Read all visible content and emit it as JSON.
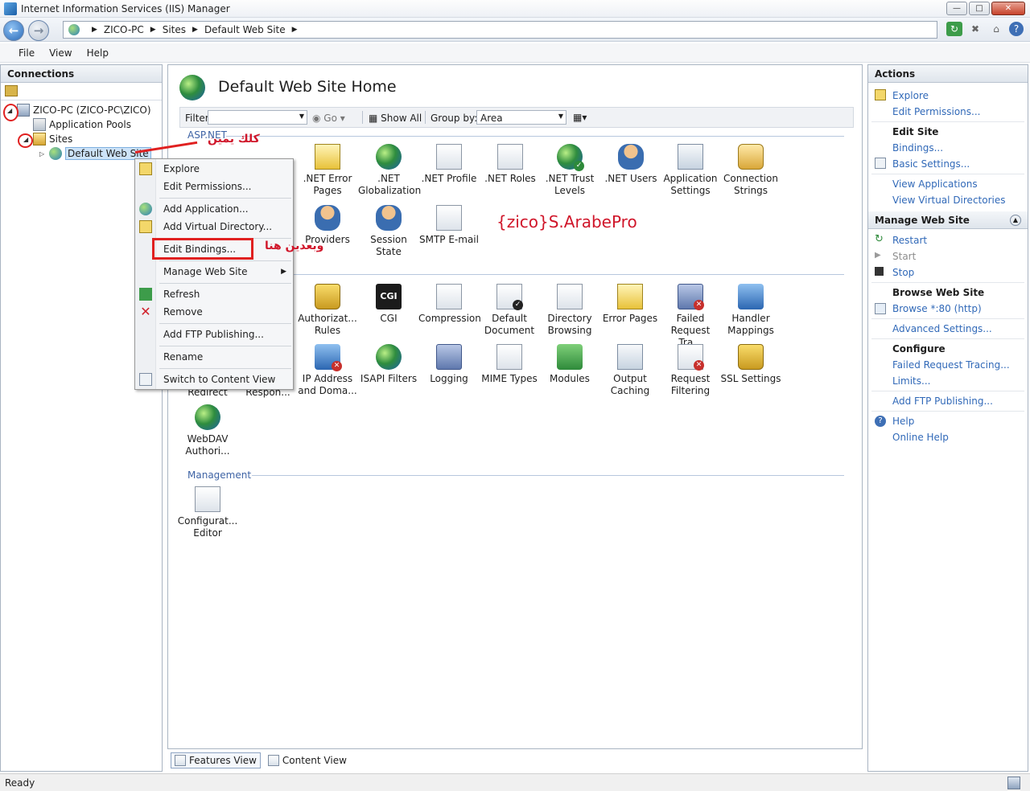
{
  "window": {
    "title": "Internet Information Services (IIS) Manager"
  },
  "address": {
    "crumbs": [
      "ZICO-PC",
      "Sites",
      "Default Web Site"
    ]
  },
  "menu": [
    "File",
    "View",
    "Help"
  ],
  "connections": {
    "header": "Connections",
    "tree": {
      "server": "ZICO-PC (ZICO-PC\\ZICO)",
      "pools": "Application Pools",
      "sites": "Sites",
      "site": "Default Web Site"
    }
  },
  "content": {
    "title": "Default Web Site Home",
    "filter": {
      "label": "Filter:",
      "go": "Go",
      "show_all": "Show All",
      "group_by": "Group by:",
      "group_value": "Area"
    },
    "sections": {
      "aspnet": "ASP.NET",
      "management": "Management"
    },
    "aspnet_items": [
      {
        "l1": ".NET Error",
        "l2": "Pages",
        "icon": "error-pages-icon"
      },
      {
        "l1": ".NET",
        "l2": "Globalization",
        "icon": "globalization-icon"
      },
      {
        "l1": ".NET Profile",
        "l2": "",
        "icon": "profile-icon"
      },
      {
        "l1": ".NET Roles",
        "l2": "",
        "icon": "roles-icon"
      },
      {
        "l1": ".NET Trust",
        "l2": "Levels",
        "icon": "trust-levels-icon"
      },
      {
        "l1": ".NET Users",
        "l2": "",
        "icon": "users-icon"
      },
      {
        "l1": "Application",
        "l2": "Settings",
        "icon": "application-settings-icon"
      },
      {
        "l1": "Connection",
        "l2": "Strings",
        "icon": "connection-strings-icon"
      }
    ],
    "aspnet_row2": [
      {
        "l1": "Providers",
        "icon": "providers-icon"
      },
      {
        "l1": "Session State",
        "icon": "session-state-icon"
      },
      {
        "l1": "SMTP E-mail",
        "icon": "smtp-email-icon"
      }
    ],
    "iis_row1": [
      {
        "l1": "Authorizat...",
        "l2": "Rules",
        "icon": "authorization-rules-icon"
      },
      {
        "l1": "CGI",
        "l2": "",
        "icon": "cgi-icon"
      },
      {
        "l1": "Compression",
        "l2": "",
        "icon": "compression-icon"
      },
      {
        "l1": "Default",
        "l2": "Document",
        "icon": "default-document-icon"
      },
      {
        "l1": "Directory",
        "l2": "Browsing",
        "icon": "directory-browsing-icon"
      },
      {
        "l1": "Error Pages",
        "l2": "",
        "icon": "error-pages-icon"
      },
      {
        "l1": "Failed",
        "l2": "Request Tra...",
        "icon": "failed-request-tracing-icon"
      },
      {
        "l1": "Handler",
        "l2": "Mappings",
        "icon": "handler-mappings-icon"
      }
    ],
    "iis_row2_partial": [
      {
        "l1": "Redirect"
      },
      {
        "l1": "Respon..."
      }
    ],
    "iis_row2": [
      {
        "l1": "IP Address",
        "l2": "and Doma...",
        "icon": "ip-address-icon"
      },
      {
        "l1": "ISAPI Filters",
        "l2": "",
        "icon": "isapi-filters-icon"
      },
      {
        "l1": "Logging",
        "l2": "",
        "icon": "logging-icon"
      },
      {
        "l1": "MIME Types",
        "l2": "",
        "icon": "mime-types-icon"
      },
      {
        "l1": "Modules",
        "l2": "",
        "icon": "modules-icon"
      },
      {
        "l1": "Output",
        "l2": "Caching",
        "icon": "output-caching-icon"
      },
      {
        "l1": "Request",
        "l2": "Filtering",
        "icon": "request-filtering-icon"
      },
      {
        "l1": "SSL Settings",
        "l2": "",
        "icon": "ssl-settings-icon"
      }
    ],
    "iis_row3": [
      {
        "l1": "WebDAV",
        "l2": "Authori...",
        "icon": "webdav-icon"
      }
    ],
    "management_items": [
      {
        "l1": "Configurat...",
        "l2": "Editor",
        "icon": "configuration-editor-icon"
      }
    ],
    "watermark": "{zico}S.ArabePro",
    "view_tabs": [
      "Features View",
      "Content View"
    ]
  },
  "context_menu": {
    "items": [
      "Explore",
      "Edit Permissions...",
      "Add Application...",
      "Add Virtual Directory...",
      "Edit Bindings...",
      "Manage Web Site",
      "Refresh",
      "Remove",
      "Add FTP Publishing...",
      "Rename",
      "Switch to Content View"
    ]
  },
  "annotations": {
    "right_click": "كلك يمين",
    "then_here": "وبعدين هنا"
  },
  "actions": {
    "header": "Actions",
    "explore": "Explore",
    "edit_permissions": "Edit Permissions...",
    "edit_site_title": "Edit Site",
    "bindings": "Bindings...",
    "basic_settings": "Basic Settings...",
    "view_applications": "View Applications",
    "view_virtual_directories": "View Virtual Directories",
    "manage_header": "Manage Web Site",
    "restart": "Restart",
    "start": "Start",
    "stop": "Stop",
    "browse_title": "Browse Web Site",
    "browse_80": "Browse *:80 (http)",
    "advanced_settings": "Advanced Settings...",
    "configure_title": "Configure",
    "failed_request_tracing": "Failed Request Tracing...",
    "limits": "Limits...",
    "add_ftp": "Add FTP Publishing...",
    "help": "Help",
    "online_help": "Online Help"
  },
  "status": {
    "text": "Ready"
  },
  "colors": {
    "link": "#3169b8",
    "annotation": "#d0162a",
    "section": "#3e63a5"
  }
}
